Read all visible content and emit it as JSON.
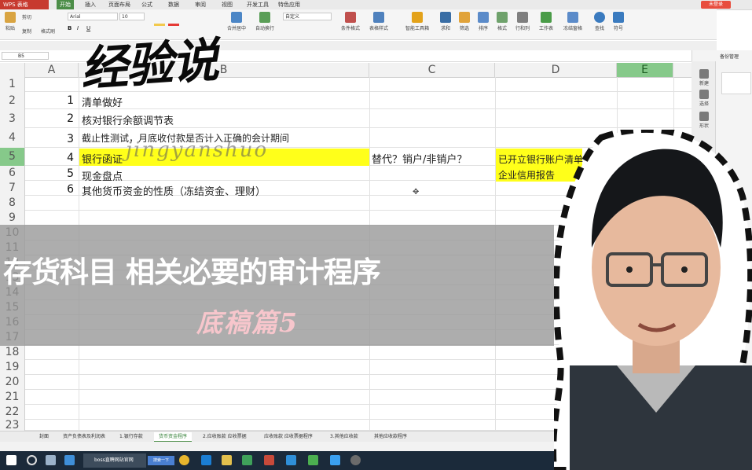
{
  "app": {
    "badge": "WPS 表格",
    "menu_tabs": [
      "开始",
      "插入",
      "页面布局",
      "公式",
      "数据",
      "审阅",
      "视图",
      "开发工具",
      "特色应用"
    ],
    "login": "未登录"
  },
  "ribbon": {
    "clipboard": [
      "粘贴",
      "剪切",
      "复制",
      "格式刷"
    ],
    "font_name": "Arial",
    "font_size": "10",
    "merge": "合并居中",
    "wrap": "自动换行",
    "number_format": "自定义",
    "groups": [
      "条件格式",
      "表格样式",
      "智能工具箱",
      "求和",
      "筛选",
      "排序",
      "格式",
      "行和列",
      "工作表",
      "冻结窗格",
      "查找",
      "符号"
    ]
  },
  "formula_bar": {
    "name_box": "B5"
  },
  "columns": [
    "A",
    "B",
    "C",
    "D",
    "E"
  ],
  "rows": [
    "1",
    "2",
    "3",
    "4",
    "5",
    "6",
    "7",
    "8",
    "9",
    "10",
    "11",
    "12",
    "13",
    "14",
    "15",
    "16",
    "17",
    "18",
    "19",
    "20",
    "21",
    "22",
    "23"
  ],
  "cells": {
    "a2": "1",
    "b2": "清单做好",
    "a3": "2",
    "b3": "核对银行余额调节表",
    "a4": "3",
    "b4": "截止性测试，月底收付款是否计入正确的会计期间",
    "a5": "4",
    "b5": "银行函证",
    "c5": "替代？销户/非销户？",
    "d5": "已开立银行账户清单",
    "a6": "5",
    "b6": "现金盘点",
    "d6": "企业信用报告",
    "a7": "6",
    "b7": "其他货币资金的性质（冻结资金、理财）"
  },
  "overlay": {
    "logo": "经验说",
    "logo_pinyin": "jingyanshuo",
    "title": "存货科目 相关必要的审计程序",
    "subtitle": "底稿篇5"
  },
  "sheet_tabs": [
    "封面",
    "资产负债表及利润表",
    "1.银行存款",
    "货币资金程序",
    "2.应收账款 应收票据",
    "应收账款 应收票据程序",
    "3.其他应收款",
    "其他应收款程序"
  ],
  "active_sheet": "货币资金程序",
  "right_panel": {
    "title": "备份管理",
    "buttons": [
      "新建",
      "选择",
      "形状"
    ]
  },
  "taskbar": {
    "browser_tab": "boss直聘网站官网",
    "search": "搜索一下"
  },
  "colors": {
    "accent": "#4b8d47",
    "wps_red": "#c73a2f",
    "highlight": "#ffff1a",
    "subtitle_pink": "#f7c6cc"
  }
}
